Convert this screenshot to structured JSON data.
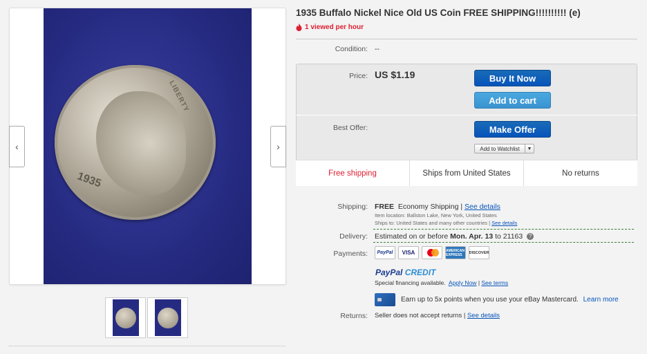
{
  "gallery": {
    "thumbnails": 2,
    "coin_year": "1935",
    "coin_legend": "LIBERTY"
  },
  "listing": {
    "title": "1935 Buffalo Nickel Nice Old US Coin FREE SHIPPING!!!!!!!!!! (e)",
    "viewed": "1 viewed per hour",
    "condition_label": "Condition:",
    "condition_value": "--",
    "price_label": "Price:",
    "price": "US $1.19",
    "buy_now": "Buy It Now",
    "add_to_cart": "Add to cart",
    "best_offer_label": "Best Offer:",
    "make_offer": "Make Offer",
    "add_to_watchlist": "Add to Watchlist"
  },
  "highlights": {
    "free_shipping": "Free shipping",
    "ships_from": "Ships from United States",
    "returns": "No returns"
  },
  "shipping": {
    "label": "Shipping:",
    "free": "FREE",
    "method": "Economy Shipping |",
    "see_details": "See details",
    "item_location": "Item location:  Ballston Lake, New York, United States",
    "ships_to": "Ships to:  United States and many other countries |",
    "ships_to_link": "See details"
  },
  "delivery": {
    "label": "Delivery:",
    "text": "Estimated on or before",
    "date": "Mon. Apr. 13",
    "to": "to 21163"
  },
  "payments": {
    "label": "Payments:",
    "logos": [
      "PayPal",
      "VISA",
      "MasterCard",
      "AMERICAN EXPRESS",
      "DISCOVER"
    ],
    "paypal_credit_a": "PayPal",
    "paypal_credit_b": "CREDIT",
    "special": "Special financing available.",
    "apply_now": "Apply Now",
    "see_terms": "See terms",
    "earn": "Earn up to 5x points when you use your eBay Mastercard.",
    "learn_more": "Learn more"
  },
  "returns": {
    "label": "Returns:",
    "text": "Seller does not accept returns |",
    "see_details": "See details"
  },
  "colors": {
    "brand_blue": "#0654ba",
    "alert_red": "#dd1e31",
    "photo_bg": "#262b82"
  }
}
